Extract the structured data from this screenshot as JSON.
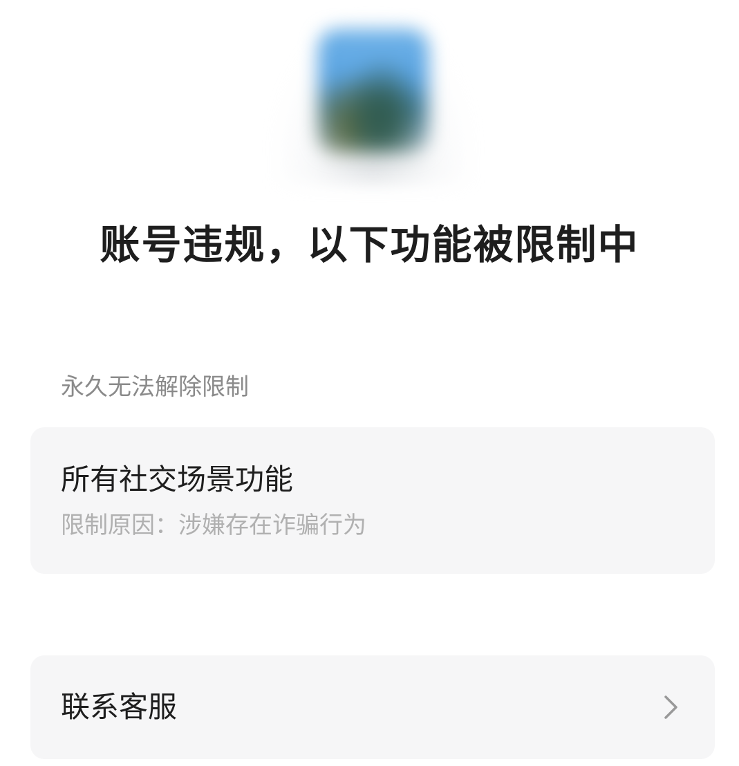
{
  "header": {
    "avatar_icon": "blurred-avatar-image",
    "title": "账号违规，以下功能被限制中"
  },
  "restriction_section": {
    "label": "永久无法解除限制",
    "items": [
      {
        "title": "所有社交场景功能",
        "reason": "限制原因：涉嫌存在诈骗行为"
      }
    ]
  },
  "support": {
    "label": "联系客服",
    "icon": "chevron-right-icon"
  },
  "colors": {
    "background": "#ffffff",
    "card": "#f6f6f7",
    "primary_text": "#1e1e1e",
    "secondary_text": "#8a8a8a",
    "muted_text": "#b0b0b0",
    "chevron": "#999999"
  }
}
